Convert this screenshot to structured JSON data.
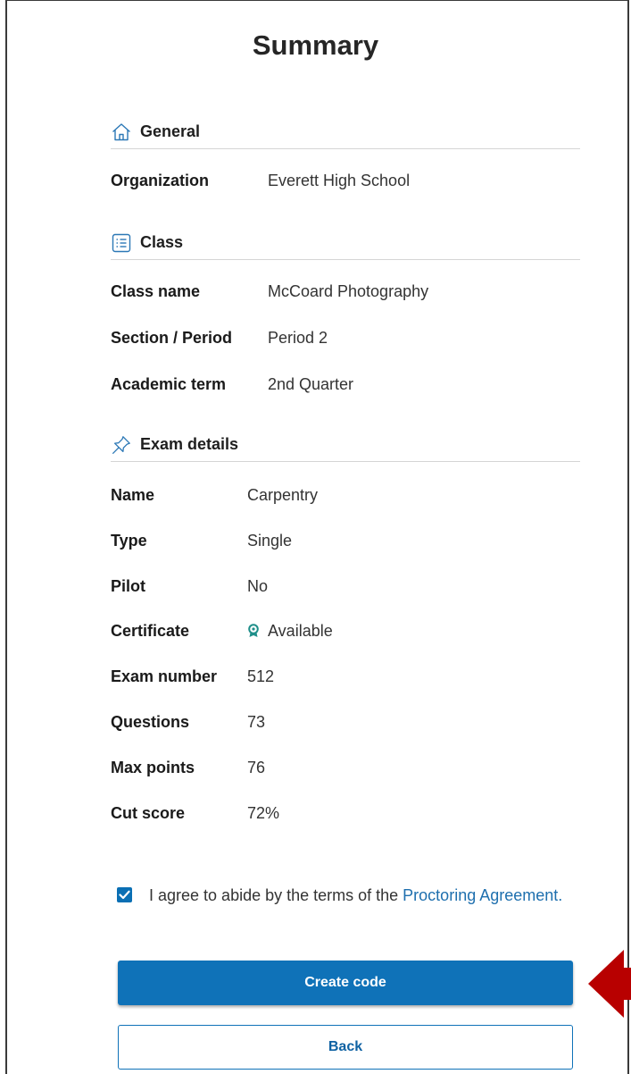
{
  "title": "Summary",
  "sections": {
    "general": {
      "heading": "General",
      "icon": "home-icon",
      "rows": [
        {
          "label": "Organization",
          "value": "Everett High School"
        }
      ]
    },
    "class": {
      "heading": "Class",
      "icon": "list-icon",
      "rows": [
        {
          "label": "Class name",
          "value": "McCoard Photography"
        },
        {
          "label": "Section / Period",
          "value": "Period 2"
        },
        {
          "label": "Academic term",
          "value": "2nd Quarter"
        }
      ]
    },
    "exam": {
      "heading": "Exam details",
      "icon": "pin-icon",
      "rows": [
        {
          "label": "Name",
          "value": "Carpentry"
        },
        {
          "label": "Type",
          "value": "Single"
        },
        {
          "label": "Pilot",
          "value": "No"
        },
        {
          "label": "Certificate",
          "value": "Available",
          "icon": "certificate-icon"
        },
        {
          "label": "Exam number",
          "value": "512"
        },
        {
          "label": "Questions",
          "value": "73"
        },
        {
          "label": "Max points",
          "value": "76"
        },
        {
          "label": "Cut score",
          "value": "72%"
        }
      ]
    }
  },
  "agreement": {
    "checked": true,
    "text": "I agree to abide by the terms of the ",
    "link_text": "Proctoring Agreement",
    "suffix": "."
  },
  "buttons": {
    "primary": "Create code",
    "secondary": "Back"
  },
  "colors": {
    "primary": "#0f72b8",
    "link": "#1e6fae",
    "accent_icon": "#1f8f8a",
    "arrow": "#b80000"
  }
}
